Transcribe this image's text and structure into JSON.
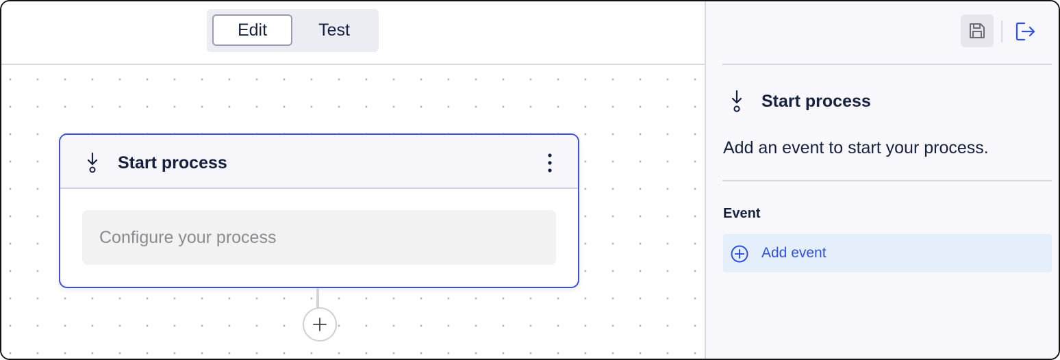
{
  "toolbar": {
    "modes": [
      {
        "label": "Edit",
        "selected": true
      },
      {
        "label": "Test",
        "selected": false
      }
    ]
  },
  "canvas": {
    "node": {
      "icon": "start-arrow-icon",
      "title": "Start process",
      "menu_icon": "kebab-menu-icon",
      "placeholder": "Configure your process"
    },
    "add_node_icon": "plus-icon"
  },
  "panel": {
    "header_icons": [
      "save-icon",
      "exit-icon"
    ],
    "title": "Start process",
    "title_icon": "start-arrow-icon",
    "description": "Add an event to start your process.",
    "event_section_label": "Event",
    "add_event_label": "Add event",
    "add_event_icon": "plus-circle-icon"
  },
  "colors": {
    "accent": "#3a4fe0",
    "link": "#2e4fe2",
    "add_event_bg": "#e4effb",
    "panel_bg": "#f7f7fc",
    "text": "#16213e"
  }
}
